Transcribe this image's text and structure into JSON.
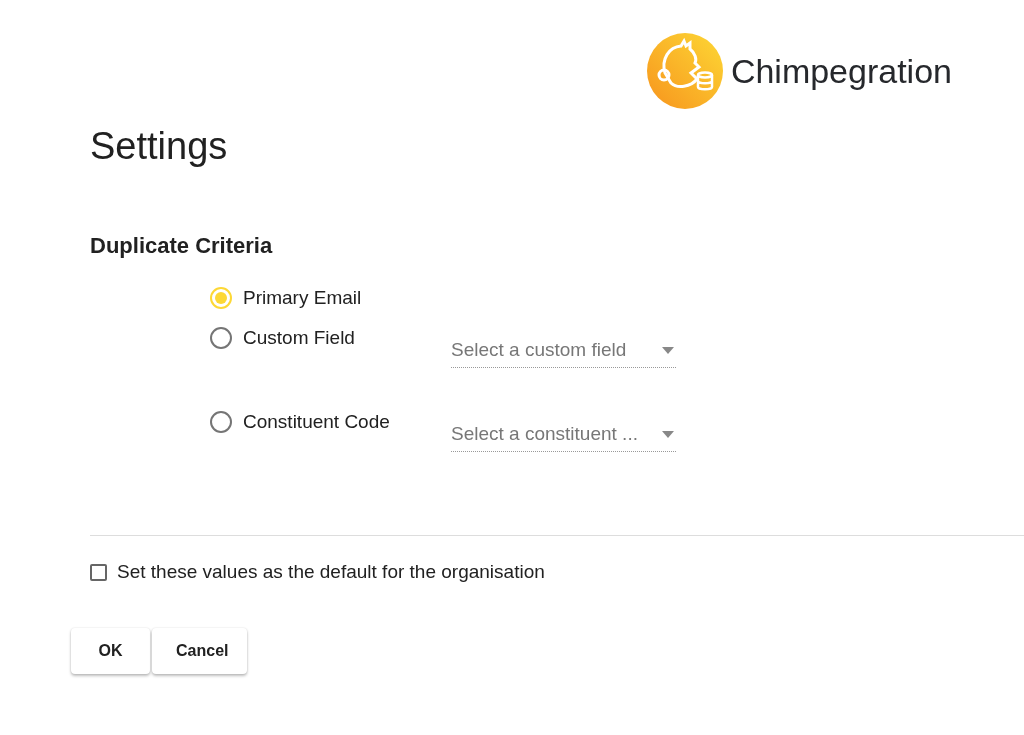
{
  "brand": {
    "name": "Chimpegration"
  },
  "title": "Settings",
  "section_title": "Duplicate Criteria",
  "options": [
    {
      "label": "Primary Email",
      "selected": true
    },
    {
      "label": "Custom Field",
      "selected": false,
      "select": {
        "placeholder": "Select a custom field"
      }
    },
    {
      "label": "Constituent Code",
      "selected": false,
      "select": {
        "placeholder": "Select a constituent ..."
      }
    }
  ],
  "default_checkbox": {
    "label": "Set these values as the default for the organisation",
    "checked": false
  },
  "buttons": [
    "OK",
    "Cancel"
  ]
}
